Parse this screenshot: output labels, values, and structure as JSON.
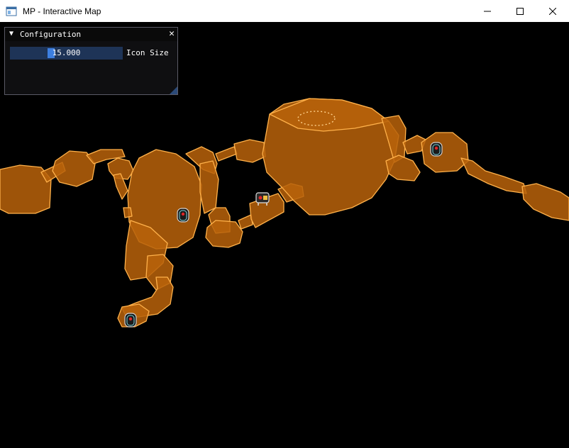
{
  "window": {
    "title": "MP - Interactive Map",
    "icon": "app-window-icon",
    "controls": [
      "minimize-icon",
      "maximize-icon",
      "close-icon"
    ]
  },
  "config_panel": {
    "collapse_arrow": "▼",
    "title": "Configuration",
    "close_glyph": "✕",
    "icon_size": {
      "value_text": "15.000",
      "label": "Icon Size",
      "value": 15.0,
      "fraction": 0.35
    }
  },
  "map": {
    "region_color": "#b8620a",
    "edge_color": "#ffb14a",
    "background": "#000000",
    "markers": [
      {
        "type": "door-icon"
      },
      {
        "type": "door-icon"
      },
      {
        "type": "door-icon"
      },
      {
        "type": "player-icon"
      }
    ]
  }
}
